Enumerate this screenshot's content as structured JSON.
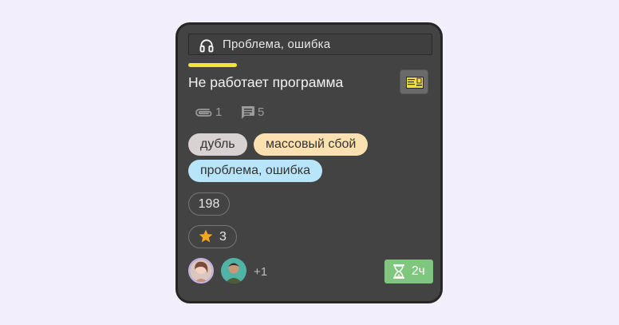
{
  "card": {
    "type_label": "Проблема, ошибка",
    "type_icon": "headset-icon",
    "priority_color": "#f4e43a",
    "title": "Не работает программа",
    "thumbnail_icon": "ticket-image-icon",
    "attachments_count": "1",
    "comments_count": "5",
    "tags": [
      {
        "label": "дубль",
        "color": "#d9d2d3"
      },
      {
        "label": "массовый сбой",
        "color": "#fbe1b0"
      },
      {
        "label": "проблема, ошибка",
        "color": "#b9e5fa"
      }
    ],
    "number": "198",
    "rating": "3",
    "rating_color": "#f6a623",
    "extra_assignees": "+1",
    "timer_label": "2ч",
    "timer_color": "#7fc77f"
  }
}
